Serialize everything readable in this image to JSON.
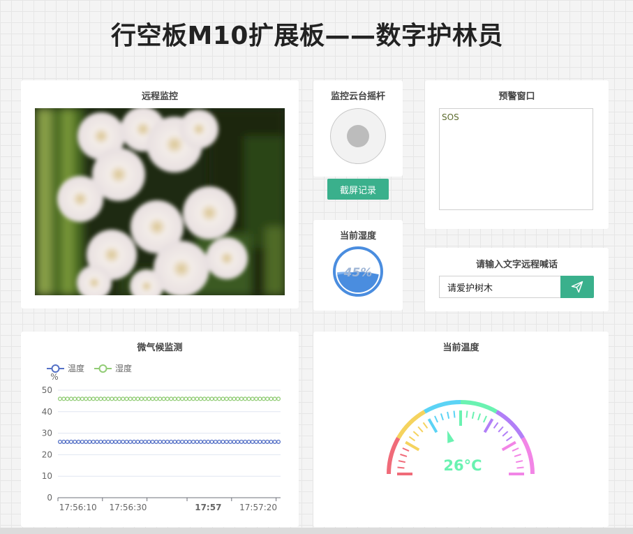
{
  "page": {
    "title": "行空板M10扩展板——数字护林员"
  },
  "monitor": {
    "title": "远程监控"
  },
  "joystick": {
    "title": "监控云台摇杆",
    "screenshot_label": "截屏记录"
  },
  "humidity": {
    "title": "当前湿度",
    "value_text": "45%",
    "level": 0.45
  },
  "warning": {
    "title": "预警窗口",
    "text": "SOS"
  },
  "shout": {
    "title": "请输入文字远程喊话",
    "input_value": "请爱护树木",
    "send_icon": "send-icon"
  },
  "climate": {
    "title": "微气候监测",
    "chart_data": {
      "type": "line",
      "unit_label": "%",
      "ylim": [
        0,
        50
      ],
      "y_ticks": [
        "0",
        "10",
        "20",
        "30",
        "40",
        "50"
      ],
      "x_ticks": [
        "17:56:10",
        "17:56:30",
        "17:57",
        "17:57:20"
      ],
      "legend_position": "top-left",
      "grid": true,
      "series": [
        {
          "name": "温度",
          "color": "#5470c6",
          "values": [
            26,
            26,
            26,
            26,
            26,
            26,
            26,
            26,
            26,
            26,
            26,
            26,
            26,
            26,
            26,
            26,
            26,
            26,
            26,
            26,
            26,
            26,
            26,
            26,
            26,
            26,
            26,
            26,
            26,
            26,
            26,
            26,
            26,
            26,
            26,
            26,
            26,
            26,
            26,
            26,
            26,
            26,
            26,
            26,
            26,
            26,
            26,
            26,
            26,
            26,
            26,
            26,
            26,
            26,
            26,
            26,
            26,
            26,
            26,
            26
          ]
        },
        {
          "name": "湿度",
          "color": "#91cc75",
          "values": [
            46,
            46,
            46,
            46,
            46,
            46,
            46,
            46,
            46,
            46,
            46,
            46,
            46,
            46,
            46,
            46,
            46,
            46,
            46,
            46,
            46,
            46,
            46,
            46,
            46,
            46,
            46,
            46,
            46,
            46,
            46,
            46,
            46,
            46,
            46,
            46,
            46,
            46,
            46,
            46,
            46,
            46,
            46,
            46,
            46,
            46,
            46,
            46,
            46,
            46,
            46,
            46,
            46,
            46,
            46,
            46,
            46,
            46,
            46,
            46
          ]
        }
      ]
    }
  },
  "thermo": {
    "title": "当前温度",
    "value_text": "26°C",
    "value": 26
  }
}
